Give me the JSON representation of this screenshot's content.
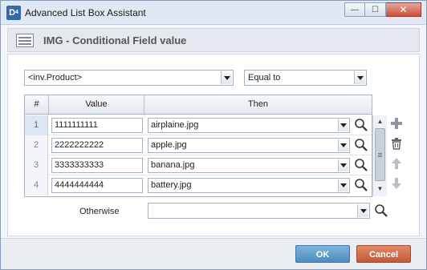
{
  "window": {
    "title": "Advanced List Box Assistant",
    "app_icon_letter": "D",
    "app_icon_sub": "4",
    "minimize_glyph": "—",
    "maximize_glyph": "☐",
    "close_glyph": "✕"
  },
  "header": {
    "title": "IMG - Conditional Field value",
    "icon": "list-icon"
  },
  "condition": {
    "field": "<inv.Product>",
    "operator": "Equal to"
  },
  "grid": {
    "columns": [
      "#",
      "Value",
      "Then"
    ],
    "rows": [
      {
        "num": "1",
        "value": "1111111111",
        "then": "airplaine.jpg",
        "selected": true
      },
      {
        "num": "2",
        "value": "2222222222",
        "then": "apple.jpg",
        "selected": false
      },
      {
        "num": "3",
        "value": "3333333333",
        "then": "banana.jpg",
        "selected": false
      },
      {
        "num": "4",
        "value": "4444444444",
        "then": "battery.jpg",
        "selected": false
      }
    ]
  },
  "scroll": {
    "up_glyph": "▲",
    "down_glyph": "▼"
  },
  "side_actions": [
    "add-icon",
    "delete-icon",
    "move-up-icon",
    "move-down-icon"
  ],
  "otherwise": {
    "label": "Otherwise",
    "value": ""
  },
  "buttons": {
    "ok": "OK",
    "cancel": "Cancel"
  },
  "colors": {
    "ok": "#5b9bcb",
    "cancel": "#d26f48",
    "accent": "#3569a8"
  }
}
